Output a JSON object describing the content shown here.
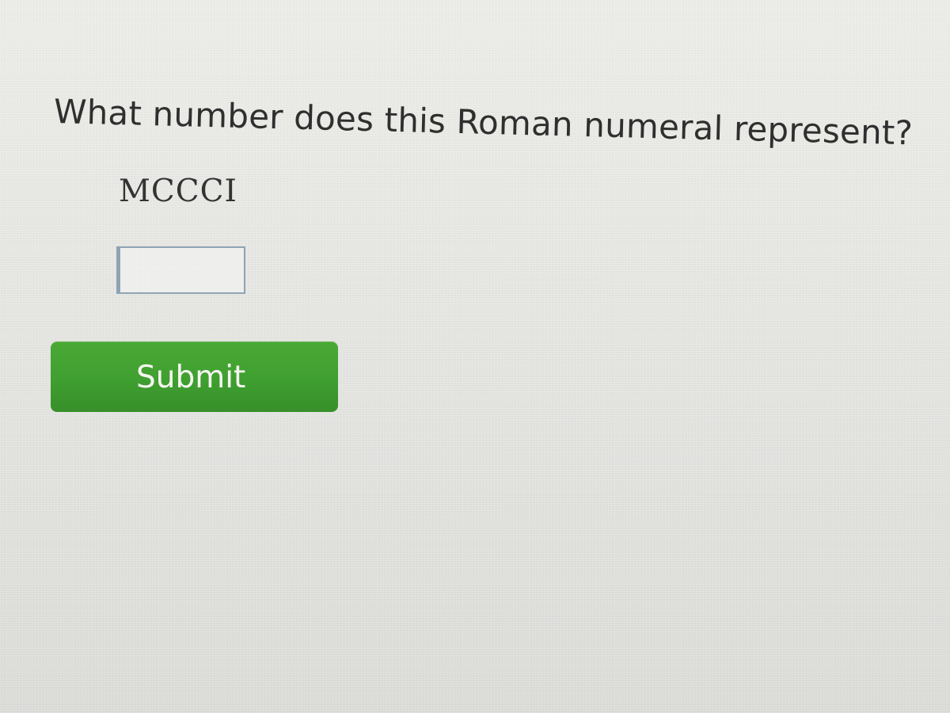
{
  "prompt": {
    "question": "What number does this Roman numeral represent?",
    "numeral": "MCCCI"
  },
  "answer": {
    "value": "",
    "placeholder": ""
  },
  "actions": {
    "submit_label": "Submit"
  },
  "colors": {
    "background": "#e9e9e6",
    "text": "#2f2f2f",
    "submit_button": "#3f9f30",
    "submit_text": "#f5f5f0",
    "input_border": "#8fa3b4"
  }
}
